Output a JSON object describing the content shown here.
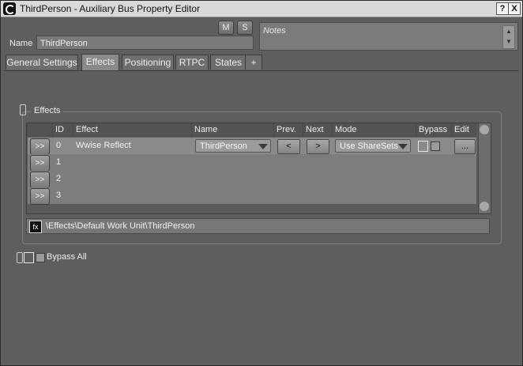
{
  "window": {
    "title": "ThirdPerson - Auxiliary Bus Property Editor",
    "help_label": "?",
    "close_label": "X"
  },
  "header": {
    "mute_label": "M",
    "solo_label": "S",
    "name_label": "Name",
    "name_value": "ThirdPerson",
    "notes_placeholder": "Notes"
  },
  "tabs": [
    {
      "label": "General Settings"
    },
    {
      "label": "Effects"
    },
    {
      "label": "Positioning"
    },
    {
      "label": "RTPC"
    },
    {
      "label": "States"
    },
    {
      "label": "+"
    }
  ],
  "effects": {
    "group_title": "Effects",
    "columns": [
      "ID",
      "Effect",
      "Name",
      "Prev.",
      "Next",
      "Mode",
      "Bypass",
      "Edit"
    ],
    "rows": [
      {
        "go": ">>",
        "id": "0",
        "effect": "Wwise Reflect",
        "name": "ThirdPerson",
        "prev": "<",
        "next": ">",
        "mode": "Use ShareSets",
        "edit": "..."
      },
      {
        "go": ">>",
        "id": "1"
      },
      {
        "go": ">>",
        "id": "2"
      },
      {
        "go": ">>",
        "id": "3"
      }
    ],
    "path": "\\Effects\\Default Work Unit\\ThirdPerson",
    "bypass_all_label": "Bypass All"
  },
  "colors": {
    "background": "#5e5e5e",
    "selected_row": "#8a8a8a",
    "titlebar": "#d9d9d9"
  }
}
